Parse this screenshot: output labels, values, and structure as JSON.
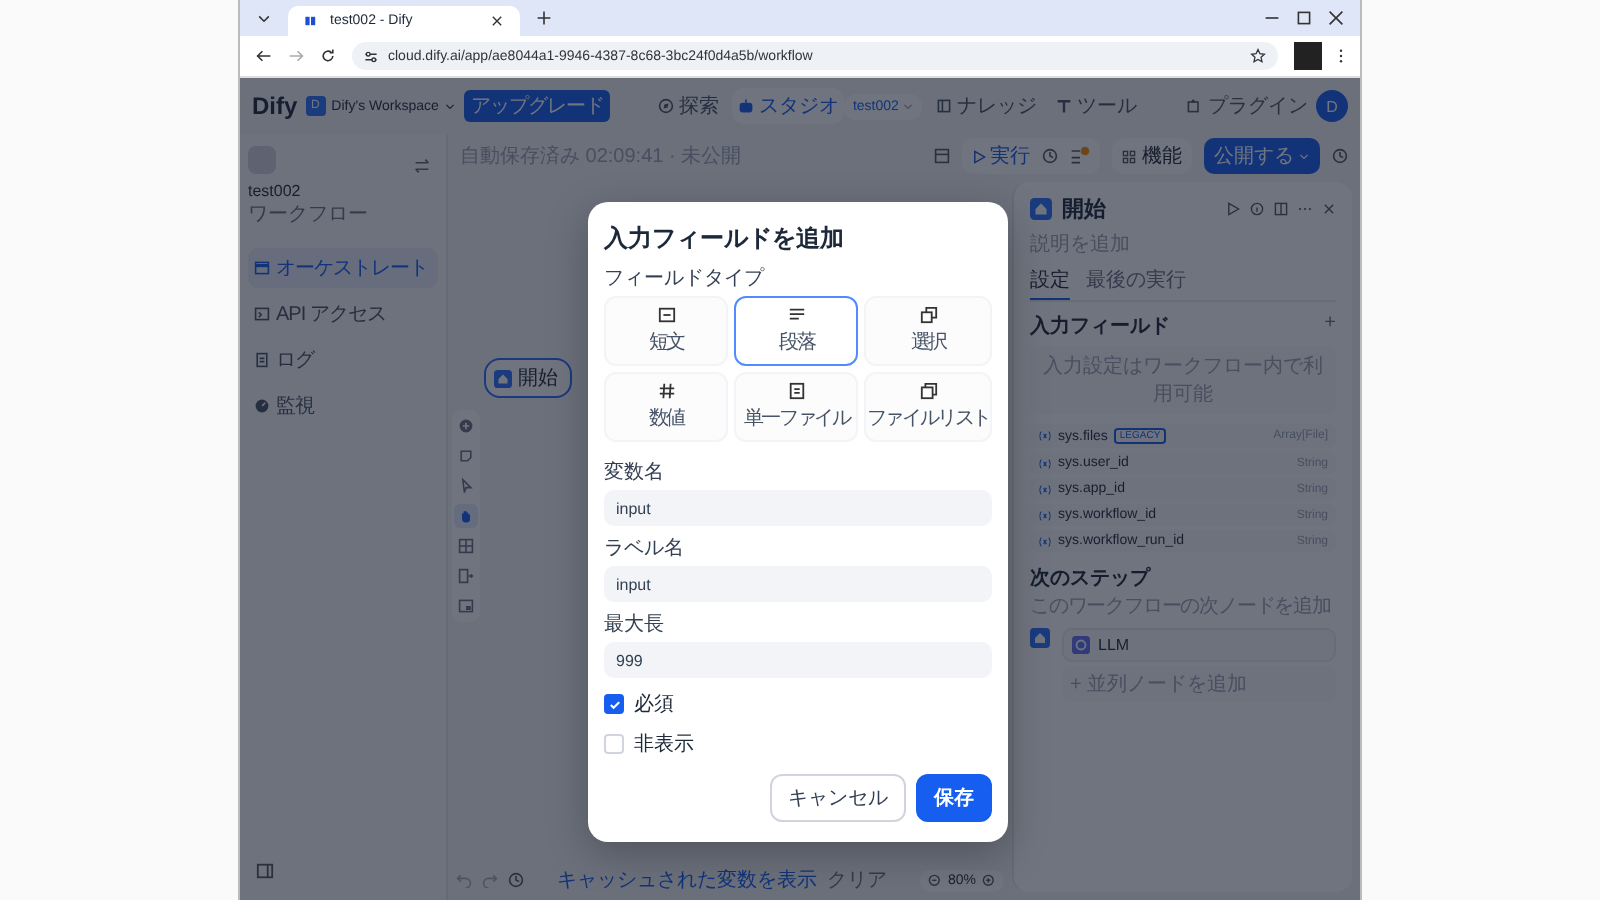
{
  "browser": {
    "tab_title": "test002 - Dify",
    "url": "cloud.dify.ai/app/ae8044a1-9946-4387-8c68-3bc24f0d4a5b/workflow"
  },
  "header": {
    "logo": "Dify",
    "workspace_icon": "D",
    "workspace": "Dify's Workspace",
    "upgrade": "アップグレード",
    "app_name": "test002",
    "plugin": "プラグイン",
    "avatar": "D",
    "nav": [
      {
        "kind": "explore",
        "label": "探索",
        "selected": false
      },
      {
        "kind": "studio",
        "label": "スタジオ",
        "selected": true
      },
      {
        "kind": "knowledge",
        "label": "ナレッジ",
        "selected": false
      },
      {
        "kind": "tools",
        "label": "ツール",
        "selected": false
      }
    ]
  },
  "sidebar": {
    "app_name": "test002",
    "app_type": "ワークフロー",
    "items": [
      {
        "kind": "orchestrate",
        "label": "オーケストレート",
        "selected": true
      },
      {
        "kind": "api",
        "label": "API アクセス",
        "selected": false
      },
      {
        "kind": "logs",
        "label": "ログ",
        "selected": false
      },
      {
        "kind": "monitor",
        "label": "監視",
        "selected": false
      }
    ]
  },
  "toolbar": {
    "status": "自動保存済み 02:09:41 · 未公開",
    "run": "実行",
    "features": "機能",
    "publish": "公開する"
  },
  "canvas": {
    "node": "開始",
    "cache_link": "キャッシュされた変数を表示",
    "clear": "クリア",
    "zoom": "80%",
    "tools": [
      {
        "kind": "add",
        "selected": false
      },
      {
        "kind": "note",
        "selected": false
      },
      {
        "kind": "pointer",
        "selected": false
      },
      {
        "kind": "hand",
        "selected": true
      },
      {
        "kind": "layout",
        "selected": false
      },
      {
        "kind": "export",
        "selected": false
      },
      {
        "kind": "minimap",
        "selected": false
      }
    ]
  },
  "panel": {
    "title": "開始",
    "description": "説明を追加",
    "tabs": [
      {
        "label": "設定",
        "selected": true
      },
      {
        "label": "最後の実行",
        "selected": false
      }
    ],
    "section": "入力フィールド",
    "add": "+",
    "hint": "入力設定はワークフロー内で利用可能",
    "variables": [
      {
        "name": "sys.files",
        "badge": "LEGACY",
        "type": "Array[File]"
      },
      {
        "name": "sys.user_id",
        "type": "String"
      },
      {
        "name": "sys.app_id",
        "type": "String"
      },
      {
        "name": "sys.workflow_id",
        "type": "String"
      },
      {
        "name": "sys.workflow_run_id",
        "type": "String"
      }
    ],
    "next_title": "次のステップ",
    "next_hint": "このワークフローの次ノードを追加",
    "next_node": "LLM",
    "parallel": "+ 並列ノードを追加"
  },
  "modal": {
    "title": "入力フィールドを追加",
    "type_label": "フィールドタイプ",
    "types": [
      {
        "kind": "short",
        "label": "短文",
        "selected": false
      },
      {
        "kind": "paragraph",
        "label": "段落",
        "selected": true
      },
      {
        "kind": "select",
        "label": "選択",
        "selected": false
      },
      {
        "kind": "number",
        "label": "数値",
        "selected": false
      },
      {
        "kind": "file",
        "label": "単一ファイル",
        "selected": false
      },
      {
        "kind": "filelist",
        "label": "ファイルリスト",
        "selected": false
      }
    ],
    "fields": [
      {
        "label": "変数名",
        "value": "input"
      },
      {
        "label": "ラベル名",
        "value": "input"
      },
      {
        "label": "最大長",
        "value": "999"
      }
    ],
    "options": [
      {
        "label": "必須",
        "checked": true
      },
      {
        "label": "非表示",
        "checked": false
      }
    ],
    "cancel": "キャンセル",
    "save": "保存"
  }
}
